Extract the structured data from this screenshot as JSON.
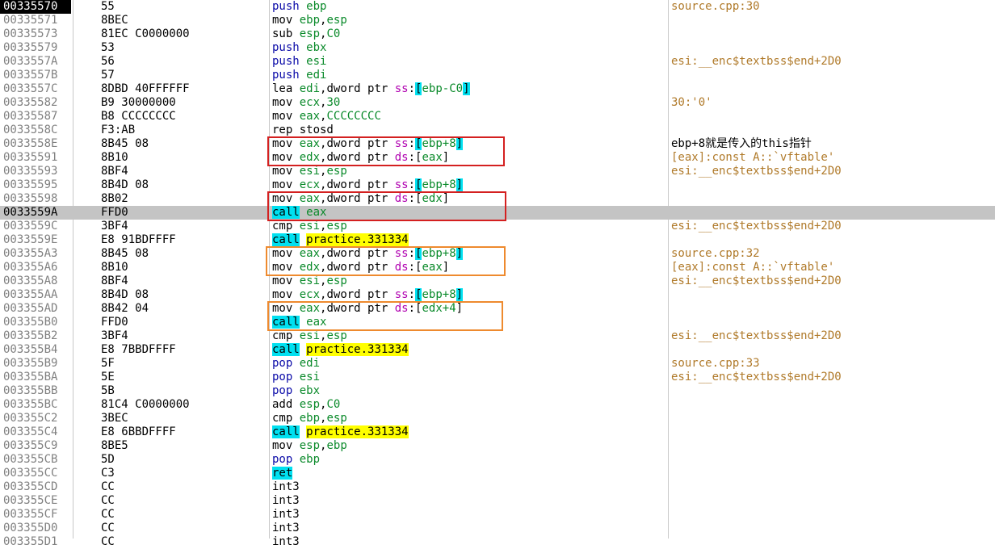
{
  "window": {
    "title": ""
  },
  "rows": [
    {
      "addr": "00335570",
      "bytes": "55",
      "asm": [
        [
          "push",
          "mn push"
        ],
        [
          " "
        ],
        [
          "ebp",
          "reg"
        ]
      ],
      "cmt": "source.cpp:30",
      "sel": true
    },
    {
      "addr": "00335571",
      "bytes": "8BEC",
      "asm": [
        [
          "mov",
          "mn"
        ],
        [
          " "
        ],
        [
          "ebp",
          "reg"
        ],
        [
          ","
        ],
        [
          "esp",
          "reg"
        ]
      ],
      "cmt": ""
    },
    {
      "addr": "00335573",
      "bytes": "81EC C0000000",
      "asm": [
        [
          "sub",
          "mn"
        ],
        [
          " "
        ],
        [
          "esp",
          "reg"
        ],
        [
          ","
        ],
        [
          "C0",
          "num"
        ]
      ],
      "cmt": ""
    },
    {
      "addr": "00335579",
      "bytes": "53",
      "asm": [
        [
          "push",
          "mn push"
        ],
        [
          " "
        ],
        [
          "ebx",
          "reg"
        ]
      ],
      "cmt": ""
    },
    {
      "addr": "0033557A",
      "bytes": "56",
      "asm": [
        [
          "push",
          "mn push"
        ],
        [
          " "
        ],
        [
          "esi",
          "reg"
        ]
      ],
      "cmt": "esi:__enc$textbss$end+2D0"
    },
    {
      "addr": "0033557B",
      "bytes": "57",
      "asm": [
        [
          "push",
          "mn push"
        ],
        [
          " "
        ],
        [
          "edi",
          "reg"
        ]
      ],
      "cmt": ""
    },
    {
      "addr": "0033557C",
      "bytes": "8DBD 40FFFFFF",
      "asm": [
        [
          "lea",
          "mn"
        ],
        [
          " "
        ],
        [
          "edi",
          "reg"
        ],
        [
          ",dword ptr "
        ],
        [
          "ss",
          "seg"
        ],
        [
          ":"
        ],
        [
          "[",
          "br"
        ],
        [
          "ebp-C0",
          "reg"
        ],
        [
          "]",
          "br"
        ]
      ],
      "cmt": ""
    },
    {
      "addr": "00335582",
      "bytes": "B9 30000000",
      "asm": [
        [
          "mov",
          "mn"
        ],
        [
          " "
        ],
        [
          "ecx",
          "reg"
        ],
        [
          ","
        ],
        [
          "30",
          "num"
        ]
      ],
      "cmt": "30:'0'"
    },
    {
      "addr": "00335587",
      "bytes": "B8 CCCCCCCC",
      "asm": [
        [
          "mov",
          "mn"
        ],
        [
          " "
        ],
        [
          "eax",
          "reg"
        ],
        [
          ","
        ],
        [
          "CCCCCCCC",
          "num"
        ]
      ],
      "cmt": ""
    },
    {
      "addr": "0033558C",
      "bytes": "F3:AB",
      "asm": [
        [
          "rep stosd",
          "mn"
        ]
      ],
      "cmt": ""
    },
    {
      "addr": "0033558E",
      "bytes": "8B45 08",
      "asm": [
        [
          "mov",
          "mn"
        ],
        [
          " "
        ],
        [
          "eax",
          "reg"
        ],
        [
          ",dword ptr "
        ],
        [
          "ss",
          "seg"
        ],
        [
          ":"
        ],
        [
          "[",
          "br"
        ],
        [
          "ebp+8",
          "reg"
        ],
        [
          "]",
          "br"
        ]
      ],
      "cmt": "ebp+8就是传入的this指针",
      "cmtBlack": true
    },
    {
      "addr": "00335591",
      "bytes": "8B10",
      "asm": [
        [
          "mov",
          "mn"
        ],
        [
          " "
        ],
        [
          "edx",
          "reg"
        ],
        [
          ",dword ptr "
        ],
        [
          "ds",
          "seg"
        ],
        [
          ":"
        ],
        [
          "[",
          "br2"
        ],
        [
          "eax",
          "reg"
        ],
        [
          "]",
          "br2"
        ]
      ],
      "cmt": "[eax]:const A::`vftable'"
    },
    {
      "addr": "00335593",
      "bytes": "8BF4",
      "asm": [
        [
          "mov",
          "mn"
        ],
        [
          " "
        ],
        [
          "esi",
          "reg"
        ],
        [
          ","
        ],
        [
          "esp",
          "reg"
        ]
      ],
      "cmt": "esi:__enc$textbss$end+2D0"
    },
    {
      "addr": "00335595",
      "bytes": "8B4D 08",
      "asm": [
        [
          "mov",
          "mn"
        ],
        [
          " "
        ],
        [
          "ecx",
          "reg"
        ],
        [
          ",dword ptr "
        ],
        [
          "ss",
          "seg"
        ],
        [
          ":"
        ],
        [
          "[",
          "br"
        ],
        [
          "ebp+8",
          "reg"
        ],
        [
          "]",
          "br"
        ]
      ],
      "cmt": ""
    },
    {
      "addr": "00335598",
      "bytes": "8B02",
      "asm": [
        [
          "mov",
          "mn"
        ],
        [
          " "
        ],
        [
          "eax",
          "reg"
        ],
        [
          ",dword ptr "
        ],
        [
          "ds",
          "seg"
        ],
        [
          ":"
        ],
        [
          "[",
          "br2"
        ],
        [
          "edx",
          "reg"
        ],
        [
          "]",
          "br2"
        ]
      ],
      "cmt": ""
    },
    {
      "addr": "0033559A",
      "bytes": "FFD0",
      "asm": [
        [
          "call",
          "mn call"
        ],
        [
          " "
        ],
        [
          "eax",
          "reg"
        ]
      ],
      "cmt": "",
      "hl": true
    },
    {
      "addr": "0033559C",
      "bytes": "3BF4",
      "asm": [
        [
          "cmp",
          "mn"
        ],
        [
          " "
        ],
        [
          "esi",
          "reg"
        ],
        [
          ","
        ],
        [
          "esp",
          "reg"
        ]
      ],
      "cmt": "esi:__enc$textbss$end+2D0"
    },
    {
      "addr": "0033559E",
      "bytes": "E8 91BDFFFF",
      "asm": [
        [
          "call",
          "mn call"
        ],
        [
          " "
        ],
        [
          "practice.331334",
          "tgt"
        ]
      ],
      "cmt": ""
    },
    {
      "addr": "003355A3",
      "bytes": "8B45 08",
      "asm": [
        [
          "mov",
          "mn"
        ],
        [
          " "
        ],
        [
          "eax",
          "reg"
        ],
        [
          ",dword ptr "
        ],
        [
          "ss",
          "seg"
        ],
        [
          ":"
        ],
        [
          "[",
          "br"
        ],
        [
          "ebp+8",
          "reg"
        ],
        [
          "]",
          "br"
        ]
      ],
      "cmt": "source.cpp:32"
    },
    {
      "addr": "003355A6",
      "bytes": "8B10",
      "asm": [
        [
          "mov",
          "mn"
        ],
        [
          " "
        ],
        [
          "edx",
          "reg"
        ],
        [
          ",dword ptr "
        ],
        [
          "ds",
          "seg"
        ],
        [
          ":"
        ],
        [
          "[",
          "br2"
        ],
        [
          "eax",
          "reg"
        ],
        [
          "]",
          "br2"
        ]
      ],
      "cmt": "[eax]:const A::`vftable'"
    },
    {
      "addr": "003355A8",
      "bytes": "8BF4",
      "asm": [
        [
          "mov",
          "mn"
        ],
        [
          " "
        ],
        [
          "esi",
          "reg"
        ],
        [
          ","
        ],
        [
          "esp",
          "reg"
        ]
      ],
      "cmt": "esi:__enc$textbss$end+2D0"
    },
    {
      "addr": "003355AA",
      "bytes": "8B4D 08",
      "asm": [
        [
          "mov",
          "mn"
        ],
        [
          " "
        ],
        [
          "ecx",
          "reg"
        ],
        [
          ",dword ptr "
        ],
        [
          "ss",
          "seg"
        ],
        [
          ":"
        ],
        [
          "[",
          "br"
        ],
        [
          "ebp+8",
          "reg"
        ],
        [
          "]",
          "br"
        ]
      ],
      "cmt": ""
    },
    {
      "addr": "003355AD",
      "bytes": "8B42 04",
      "asm": [
        [
          "mov",
          "mn"
        ],
        [
          " "
        ],
        [
          "eax",
          "reg"
        ],
        [
          ",dword ptr "
        ],
        [
          "ds",
          "seg"
        ],
        [
          ":"
        ],
        [
          "[",
          "br2"
        ],
        [
          "edx+4",
          "reg"
        ],
        [
          "]",
          "br2"
        ]
      ],
      "cmt": ""
    },
    {
      "addr": "003355B0",
      "bytes": "FFD0",
      "asm": [
        [
          "call",
          "mn call"
        ],
        [
          " "
        ],
        [
          "eax",
          "reg"
        ]
      ],
      "cmt": ""
    },
    {
      "addr": "003355B2",
      "bytes": "3BF4",
      "asm": [
        [
          "cmp",
          "mn"
        ],
        [
          " "
        ],
        [
          "esi",
          "reg"
        ],
        [
          ","
        ],
        [
          "esp",
          "reg"
        ]
      ],
      "cmt": "esi:__enc$textbss$end+2D0"
    },
    {
      "addr": "003355B4",
      "bytes": "E8 7BBDFFFF",
      "asm": [
        [
          "call",
          "mn call"
        ],
        [
          " "
        ],
        [
          "practice.331334",
          "tgt"
        ]
      ],
      "cmt": ""
    },
    {
      "addr": "003355B9",
      "bytes": "5F",
      "asm": [
        [
          "pop",
          "mn pop"
        ],
        [
          " "
        ],
        [
          "edi",
          "reg"
        ]
      ],
      "cmt": "source.cpp:33"
    },
    {
      "addr": "003355BA",
      "bytes": "5E",
      "asm": [
        [
          "pop",
          "mn pop"
        ],
        [
          " "
        ],
        [
          "esi",
          "reg"
        ]
      ],
      "cmt": "esi:__enc$textbss$end+2D0"
    },
    {
      "addr": "003355BB",
      "bytes": "5B",
      "asm": [
        [
          "pop",
          "mn pop"
        ],
        [
          " "
        ],
        [
          "ebx",
          "reg"
        ]
      ],
      "cmt": ""
    },
    {
      "addr": "003355BC",
      "bytes": "81C4 C0000000",
      "asm": [
        [
          "add",
          "mn"
        ],
        [
          " "
        ],
        [
          "esp",
          "reg"
        ],
        [
          ","
        ],
        [
          "C0",
          "num"
        ]
      ],
      "cmt": ""
    },
    {
      "addr": "003355C2",
      "bytes": "3BEC",
      "asm": [
        [
          "cmp",
          "mn"
        ],
        [
          " "
        ],
        [
          "ebp",
          "reg"
        ],
        [
          ","
        ],
        [
          "esp",
          "reg"
        ]
      ],
      "cmt": ""
    },
    {
      "addr": "003355C4",
      "bytes": "E8 6BBDFFFF",
      "asm": [
        [
          "call",
          "mn call"
        ],
        [
          " "
        ],
        [
          "practice.331334",
          "tgt"
        ]
      ],
      "cmt": ""
    },
    {
      "addr": "003355C9",
      "bytes": "8BE5",
      "asm": [
        [
          "mov",
          "mn"
        ],
        [
          " "
        ],
        [
          "esp",
          "reg"
        ],
        [
          ","
        ],
        [
          "ebp",
          "reg"
        ]
      ],
      "cmt": ""
    },
    {
      "addr": "003355CB",
      "bytes": "5D",
      "asm": [
        [
          "pop",
          "mn pop"
        ],
        [
          " "
        ],
        [
          "ebp",
          "reg"
        ]
      ],
      "cmt": ""
    },
    {
      "addr": "003355CC",
      "bytes": "C3",
      "asm": [
        [
          "ret",
          "mn ret"
        ]
      ],
      "cmt": ""
    },
    {
      "addr": "003355CD",
      "bytes": "CC",
      "asm": [
        [
          "int3",
          "mn"
        ]
      ],
      "cmt": ""
    },
    {
      "addr": "003355CE",
      "bytes": "CC",
      "asm": [
        [
          "int3",
          "mn"
        ]
      ],
      "cmt": ""
    },
    {
      "addr": "003355CF",
      "bytes": "CC",
      "asm": [
        [
          "int3",
          "mn"
        ]
      ],
      "cmt": ""
    },
    {
      "addr": "003355D0",
      "bytes": "CC",
      "asm": [
        [
          "int3",
          "mn"
        ]
      ],
      "cmt": ""
    },
    {
      "addr": "003355D1",
      "bytes": "CC",
      "asm": [
        [
          "int3",
          "mn"
        ]
      ],
      "cmt": ""
    }
  ],
  "annotations": [
    {
      "color": "red",
      "rows": [
        10,
        11
      ]
    },
    {
      "color": "red",
      "rows": [
        14,
        15
      ]
    },
    {
      "color": "orange",
      "rows": [
        18,
        19
      ]
    },
    {
      "color": "orange",
      "rows": [
        22,
        23
      ]
    }
  ],
  "colors": {
    "comment": "#b07a2a",
    "register": "#0a8a2a",
    "segment": "#b000b0",
    "call_bg": "#00e0f0",
    "target_bg": "#ffff00",
    "current_row": "#c4c4c4",
    "annot_red": "#d42020",
    "annot_orange": "#ee8a2e"
  }
}
